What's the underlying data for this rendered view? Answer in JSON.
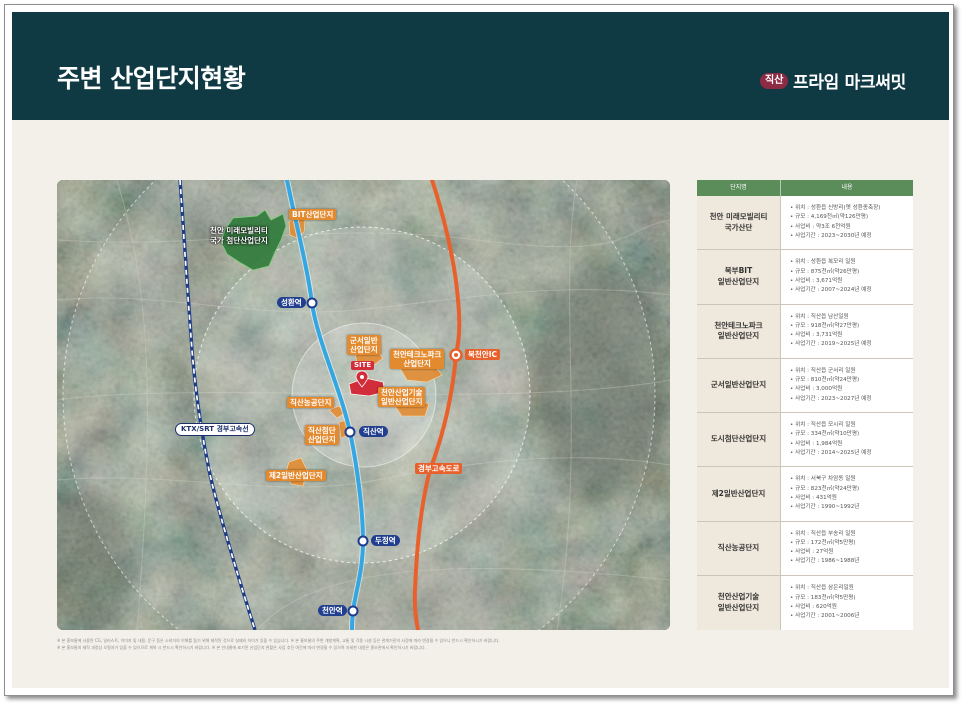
{
  "header": {
    "title": "주변 산업단지현황",
    "brand_badge": "직산",
    "brand_name": "프라임 마크써밋"
  },
  "map": {
    "labels": {
      "bit": "BIT산업단지",
      "mobility": [
        "천안 미래모빌리티",
        "국가 첨단산업단지"
      ],
      "gunseo": [
        "군서일반",
        "산업단지"
      ],
      "technopark": [
        "천안테크노파크",
        "산업단지"
      ],
      "site": "SITE",
      "industrial_tech": [
        "천안산업기술",
        "일반산업단지"
      ],
      "jiksan_agri": "직산농공단지",
      "jiksan_advanced": [
        "직산첨단",
        "산업단지"
      ],
      "second_general": "제2일반산업단지",
      "ktx": "KTX/SRT 경부고속선",
      "expressway": "경부고속도로",
      "ic": "북천안IC"
    },
    "stations": {
      "seonghwan": "성환역",
      "jiksan": "직산역",
      "dujeong": "두정역",
      "cheonan": "천안역"
    }
  },
  "table": {
    "headers": {
      "name": "단지명",
      "content": "내용"
    },
    "rows": [
      {
        "name": [
          "천안 미래모빌리티",
          "국가산단"
        ],
        "details": [
          "• 위치 : 성환읍 신방리(옛 성환종축장)",
          "• 규모 : 4,169천㎡(약126만평)",
          "• 사업비 : 약3조 6천억원",
          "• 사업기간 : 2023~2030년 예정"
        ]
      },
      {
        "name": [
          "북부BIT",
          "일반산업단지"
        ],
        "details": [
          "• 위치 : 성환읍 복모리 일원",
          "• 규모 : 875천㎡(약26만평)",
          "• 사업비 : 3,671억원",
          "• 사업기간 : 2007~2024년 예정"
        ]
      },
      {
        "name": [
          "천안테크노파크",
          "일반산업단지"
        ],
        "details": [
          "• 위치 : 직산읍 남산일원",
          "• 규모 : 918천㎡(약27만평)",
          "• 사업비 : 3,731억원",
          "• 사업기간 : 2019~2025년 예정"
        ]
      },
      {
        "name": [
          "군서일반산업단지"
        ],
        "details": [
          "• 위치 : 직산읍 군서리 일원",
          "• 규모 : 810천㎡(약24만평)",
          "• 사업비 : 3,000억원",
          "• 사업기간 : 2023~2027년 예정"
        ]
      },
      {
        "name": [
          "도시첨단산업단지"
        ],
        "details": [
          "• 위치 : 직산읍 모시리 일원",
          "• 규모 : 334천㎡(약10만평)",
          "• 사업비 : 1,984억원",
          "• 사업기간 : 2014~2025년 예정"
        ]
      },
      {
        "name": [
          "제2일반산업단지"
        ],
        "details": [
          "• 위치 : 서북구 차암동 일원",
          "• 규모 : 823천㎡(약24만평)",
          "• 사업비 : 431억원",
          "• 사업기간 : 1990~1992년"
        ]
      },
      {
        "name": [
          "직산농공단지"
        ],
        "details": [
          "• 위치 : 직산읍 부송리 일원",
          "• 규모 : 172천㎡(약5만평)",
          "• 사업비 : 27억원",
          "• 사업기간 : 1986~1988년"
        ]
      },
      {
        "name": [
          "천안산업기술",
          "일반산업단지"
        ],
        "details": [
          "• 위치 : 직산읍 삼은리일원",
          "• 규모 : 183천㎡(약5만평)",
          "• 사업비 : 620억원",
          "• 사업기간 : 2001~2006년"
        ]
      }
    ]
  },
  "footnotes": [
    "※ 본 홍보물에 사용된 CG, 일러스트, 이미지 및 내용, 문구 등은 소비자의 이해를 돕기 위해 제작된 것으로 실제와 차이가 있을 수 있습니다. ※ 본 홍보물의 주변 개발계획, 교통 및 각종 시설 등은 관계기관의 사정에 따라 변경될 수 있으니 반드시 확인하시기 바랍니다.",
    "※ 본 홍보물의 제작 과정상 오탈자가 있을 수 있으므로 계약 시 반드시 확인하시기 바랍니다. ※ 본 안내물에 표기된 산업단지 현황은 사업 추진 여건에 따라 변경될 수 있으며 자세한 내용은 홍보관에서 확인하시기 바랍니다."
  ],
  "colors": {
    "header_bg": "#0f3a44",
    "brand_badge": "#8e2b44",
    "table_header": "#5b8d5b",
    "rail_line": "#34a7e2",
    "expressway": "#e8612c",
    "label_orange": "#e38a2f",
    "site_red": "#d12d3a"
  }
}
